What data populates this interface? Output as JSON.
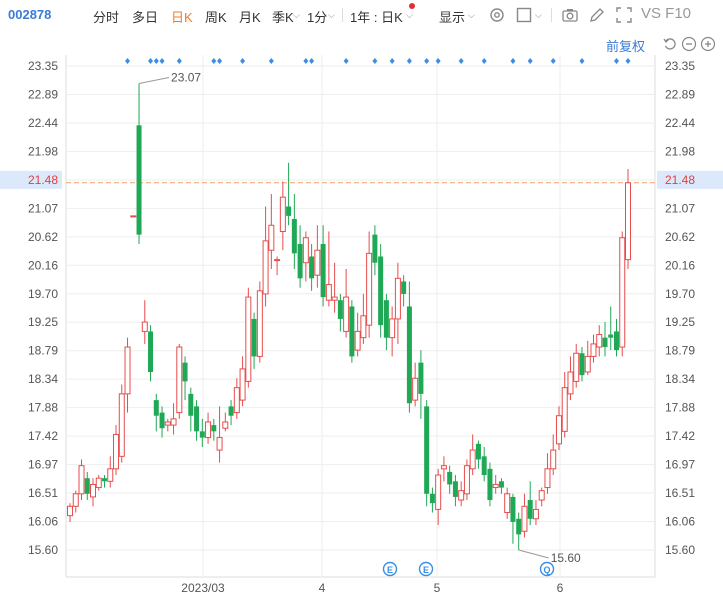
{
  "toolbar": {
    "code": "002878",
    "tabs": [
      "分时",
      "多日",
      "日K",
      "周K",
      "月K",
      "季K",
      "1分",
      "1年 : 日K",
      "显示"
    ],
    "active_tab": "日K",
    "vs_f10": "VS F10",
    "restore": "前复权"
  },
  "chart_data": {
    "type": "candlestick",
    "y_ticks": [
      "23.35",
      "22.89",
      "22.44",
      "21.98",
      "21.48",
      "21.07",
      "20.62",
      "20.16",
      "19.70",
      "19.25",
      "18.79",
      "18.34",
      "17.88",
      "17.42",
      "16.97",
      "16.51",
      "16.06",
      "15.60"
    ],
    "x_ticks": [
      "2023/03",
      "4",
      "5",
      "6"
    ],
    "ylim": [
      15.25,
      23.55
    ],
    "current_price": "21.48",
    "max_label": "23.07",
    "min_label": "15.60",
    "event_markers": [
      "E",
      "E",
      "Q"
    ],
    "colors": {
      "up": "#e84c4c",
      "down": "#1fa855",
      "ref": "#f0a070",
      "grid": "#eeeeee",
      "dots": "#3a8ee6"
    },
    "candles": [
      [
        16.15,
        16.3,
        16.05,
        16.35
      ],
      [
        16.3,
        16.5,
        16.2,
        16.55
      ],
      [
        16.5,
        16.95,
        16.4,
        17.05
      ],
      [
        16.75,
        16.5,
        16.4,
        16.85
      ],
      [
        16.45,
        16.65,
        16.3,
        16.75
      ],
      [
        16.6,
        16.75,
        16.55,
        16.8
      ],
      [
        16.75,
        16.7,
        16.6,
        16.8
      ],
      [
        16.7,
        16.9,
        16.6,
        17.1
      ],
      [
        16.9,
        17.45,
        16.8,
        17.6
      ],
      [
        17.1,
        18.1,
        17.0,
        18.25
      ],
      [
        18.1,
        18.85,
        17.8,
        19.0
      ],
      [
        20.95,
        20.95,
        20.95,
        20.95
      ],
      [
        22.4,
        20.65,
        20.5,
        23.07
      ],
      [
        19.1,
        19.25,
        18.9,
        19.6
      ],
      [
        19.1,
        18.45,
        18.3,
        19.2
      ],
      [
        18.0,
        17.75,
        17.5,
        18.1
      ],
      [
        17.8,
        17.55,
        17.4,
        17.9
      ],
      [
        17.6,
        17.65,
        17.5,
        17.7
      ],
      [
        17.6,
        17.7,
        17.45,
        17.95
      ],
      [
        17.8,
        18.85,
        17.7,
        18.9
      ],
      [
        18.6,
        18.3,
        18.0,
        18.7
      ],
      [
        18.1,
        17.75,
        17.5,
        18.2
      ],
      [
        17.9,
        17.5,
        17.35,
        18.0
      ],
      [
        17.5,
        17.4,
        17.25,
        17.7
      ],
      [
        17.4,
        17.65,
        17.3,
        17.8
      ],
      [
        17.6,
        17.5,
        17.35,
        17.7
      ],
      [
        17.2,
        17.4,
        17.0,
        17.9
      ],
      [
        17.55,
        17.65,
        17.5,
        17.8
      ],
      [
        17.9,
        17.75,
        17.6,
        18.0
      ],
      [
        17.8,
        18.2,
        17.7,
        18.35
      ],
      [
        18.0,
        18.5,
        17.9,
        18.7
      ],
      [
        18.3,
        19.65,
        18.2,
        19.8
      ],
      [
        19.3,
        18.7,
        18.5,
        19.4
      ],
      [
        18.7,
        19.75,
        18.6,
        19.9
      ],
      [
        19.7,
        20.55,
        19.5,
        21.1
      ],
      [
        20.4,
        20.8,
        20.1,
        21.3
      ],
      [
        20.25,
        20.25,
        20.0,
        20.3
      ],
      [
        20.7,
        21.25,
        20.4,
        21.5
      ],
      [
        21.1,
        20.95,
        20.8,
        21.8
      ],
      [
        20.9,
        20.35,
        20.1,
        21.3
      ],
      [
        20.5,
        19.95,
        19.8,
        20.8
      ],
      [
        20.2,
        20.6,
        19.9,
        20.7
      ],
      [
        20.3,
        19.95,
        19.75,
        20.5
      ],
      [
        20.0,
        20.4,
        19.8,
        20.8
      ],
      [
        20.5,
        19.65,
        19.5,
        20.8
      ],
      [
        19.6,
        19.85,
        19.5,
        20.7
      ],
      [
        19.6,
        19.65,
        19.4,
        20.2
      ],
      [
        19.6,
        19.3,
        19.1,
        19.7
      ],
      [
        19.1,
        19.65,
        19.0,
        20.1
      ],
      [
        19.5,
        18.7,
        18.6,
        19.6
      ],
      [
        18.8,
        19.1,
        18.7,
        19.4
      ],
      [
        19.0,
        19.35,
        18.9,
        19.7
      ],
      [
        19.2,
        20.35,
        19.0,
        20.7
      ],
      [
        20.65,
        20.2,
        20.0,
        20.8
      ],
      [
        20.3,
        19.2,
        19.0,
        20.5
      ],
      [
        19.6,
        19.0,
        18.8,
        19.7
      ],
      [
        19.0,
        19.3,
        18.7,
        19.5
      ],
      [
        19.3,
        19.95,
        18.9,
        20.2
      ],
      [
        19.9,
        19.7,
        19.5,
        20.0
      ],
      [
        19.5,
        17.95,
        17.8,
        19.9
      ],
      [
        18.0,
        18.35,
        17.9,
        18.6
      ],
      [
        18.6,
        18.1,
        17.7,
        18.8
      ],
      [
        17.9,
        16.5,
        16.3,
        18.0
      ],
      [
        16.5,
        16.35,
        16.2,
        16.6
      ],
      [
        16.25,
        16.8,
        16.0,
        16.9
      ],
      [
        16.9,
        16.95,
        16.7,
        17.1
      ],
      [
        16.85,
        16.65,
        16.5,
        16.95
      ],
      [
        16.7,
        16.45,
        16.3,
        16.8
      ],
      [
        16.4,
        16.55,
        16.3,
        16.7
      ],
      [
        16.5,
        16.95,
        16.4,
        17.05
      ],
      [
        16.9,
        17.2,
        16.8,
        17.45
      ],
      [
        17.3,
        17.05,
        16.9,
        17.35
      ],
      [
        17.1,
        16.8,
        16.7,
        17.25
      ],
      [
        16.9,
        16.4,
        16.3,
        17.0
      ],
      [
        16.6,
        16.65,
        16.5,
        16.8
      ],
      [
        16.7,
        16.6,
        16.5,
        16.75
      ],
      [
        16.2,
        16.5,
        16.1,
        16.6
      ],
      [
        16.45,
        16.05,
        15.7,
        16.5
      ],
      [
        16.1,
        15.85,
        15.6,
        16.2
      ],
      [
        15.9,
        16.3,
        15.8,
        16.5
      ],
      [
        16.4,
        16.1,
        16.0,
        16.7
      ],
      [
        16.1,
        16.25,
        16.0,
        16.4
      ],
      [
        16.4,
        16.55,
        16.3,
        16.6
      ],
      [
        16.6,
        16.9,
        16.5,
        17.15
      ],
      [
        16.9,
        17.2,
        16.8,
        17.45
      ],
      [
        17.3,
        17.75,
        17.2,
        17.9
      ],
      [
        17.5,
        18.2,
        17.4,
        18.45
      ],
      [
        18.1,
        18.45,
        18.0,
        18.7
      ],
      [
        18.3,
        18.75,
        18.2,
        18.9
      ],
      [
        18.75,
        18.4,
        18.3,
        18.85
      ],
      [
        18.45,
        18.7,
        18.4,
        18.95
      ],
      [
        18.7,
        18.9,
        18.6,
        19.05
      ],
      [
        18.85,
        19.05,
        18.7,
        19.2
      ],
      [
        19.0,
        18.85,
        18.7,
        19.25
      ],
      [
        19.05,
        19.0,
        18.8,
        19.5
      ],
      [
        19.1,
        18.8,
        18.7,
        19.3
      ],
      [
        18.85,
        20.6,
        18.7,
        20.7
      ],
      [
        20.25,
        21.48,
        20.1,
        21.7
      ]
    ]
  }
}
